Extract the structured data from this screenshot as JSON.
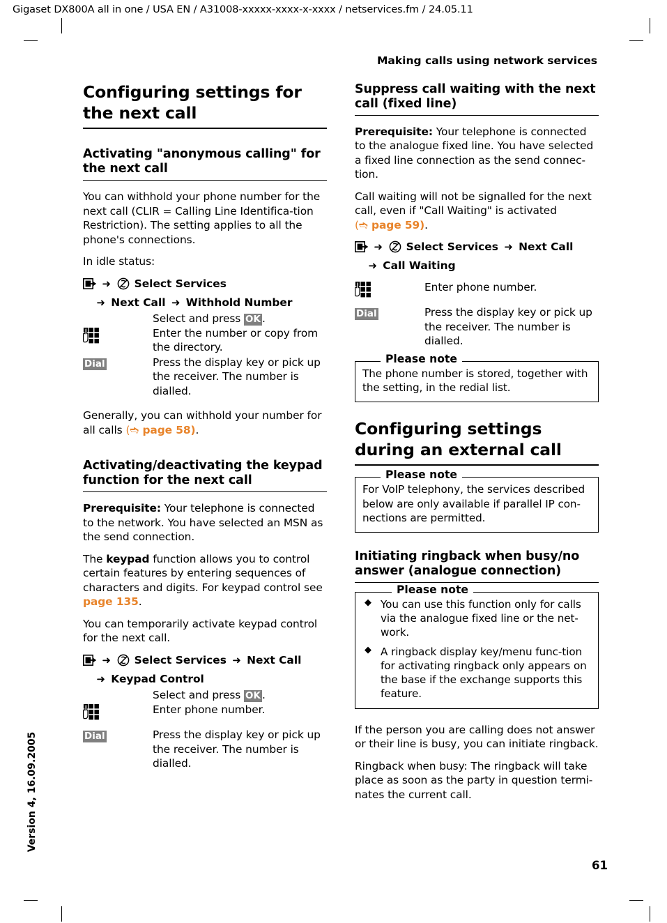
{
  "doc": {
    "slug": "Gigaset DX800A all in one / USA EN / A31008-xxxxx-xxxx-x-xxxx / netservices.fm / 24.05.11",
    "running_head": "Making calls using network services",
    "version_side": "Version 4, 16.09.2005",
    "folio": "61",
    "accent_color": "#E8842B",
    "chip_color": "#808080"
  },
  "icons": {
    "menu_key": "menu-key-icon",
    "network_services": "network-services-icon",
    "keypad": "keypad-icon",
    "arrow": "➜",
    "bullet": "◆"
  },
  "left": {
    "h1": "Configuring settings for the next call",
    "section1": {
      "h2": "Activating \"anonymous calling\" for the next call",
      "p1_a": "You can withhold your phone number for the next call (CLIR = Calling Line Identifica-tion Restriction). The setting applies to all the phone's connections.",
      "p2": "In idle status:",
      "path_line1_label": "Select Services",
      "path_line2_a": "Next Call",
      "path_line2_b": "Withhold Number",
      "step1_text_a": "Select and press ",
      "step1_key": "OK",
      "step1_text_b": ".",
      "step2_text": "Enter the number or copy from the directory.",
      "step2_key": "keypad-icon",
      "step3_key": "Dial",
      "step3_text": "Press the display key or pick up the receiver.  The number is dialled.",
      "p3_a": "Generally, you can withhold your number for all calls ",
      "p3_xref_open": "(",
      "p3_xref_page": "page 58)",
      "p3_b": "."
    },
    "section2": {
      "h2": "Activating/deactivating the keypad function for the next call",
      "p1_bold": "Prerequisite:",
      "p1_rest": " Your telephone is connected to the network. You have selected an MSN as the send connection.",
      "p2_a": "The ",
      "p2_bold": "keypad",
      "p2_b": " function allows you to control certain features by entering sequences of characters and digits. For keypad control see ",
      "p2_xref": "page 135",
      "p2_c": ".",
      "p3": "You can temporarily activate keypad control for the next call.",
      "path_line1_label": "Select Services",
      "path_line1_b": "Next Call",
      "path_line2": "Keypad Control",
      "step1_text_a": "Select and press ",
      "step1_key": "OK",
      "step1_text_b": ".",
      "step2_text": "Enter phone number.",
      "step3_key": "Dial",
      "step3_text": "Press the display key or pick up the receiver. The number is dialled."
    }
  },
  "right": {
    "section1": {
      "h2": "Suppress call waiting with the next call (fixed line)",
      "p1_bold": "Prerequisite:",
      "p1_rest": " Your telephone is connected to the analogue fixed line. You have selected a fixed line connection as the send connec-tion.",
      "p2_a": "Call waiting will not be signalled for the next call, even if \"Call Waiting\" is activated ",
      "p2_xref_open": "(",
      "p2_xref_page": "page 59)",
      "p2_b": ".",
      "path_line1_label": "Select Services",
      "path_line1_b": "Next Call",
      "path_line2": "Call Waiting",
      "step1_text": "Enter phone number.",
      "step2_key": "Dial",
      "step2_text": "Press the display key or pick up the receiver. The number is dialled.",
      "note_title": "Please note",
      "note_body": "The phone number is stored, together with the setting, in the redial list."
    },
    "section2": {
      "h1": "Configuring settings during an external call",
      "note_title": "Please note",
      "note_body": "For VoIP telephony, the services described below are only available if parallel IP con-nections are permitted."
    },
    "section3": {
      "h2": "Initiating ringback when busy/no answer (analogue connection)",
      "note_title": "Please note",
      "note_bullets": [
        "You can use this function only for calls via the analogue fixed line or the net-work.",
        "A ringback display key/menu func-tion for activating ringback only appears on the base if the exchange supports this feature."
      ],
      "p1": "If the person you are calling does not answer or their line is busy, you can initiate ringback.",
      "p2": "Ringback when busy: The ringback will take place as soon as the party in question termi-nates the current call."
    }
  }
}
